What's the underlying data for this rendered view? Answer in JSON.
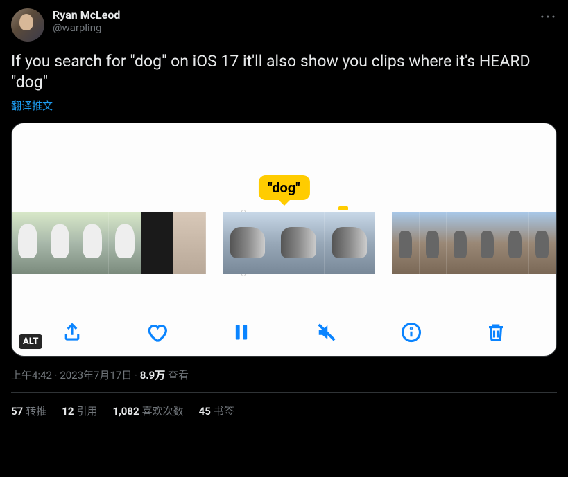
{
  "author": {
    "display_name": "Ryan McLeod",
    "handle": "@warpling"
  },
  "body": "If you search for \"dog\" on iOS 17 it'll also show you clips where it's HEARD \"dog\"",
  "translate_label": "翻译推文",
  "media": {
    "tooltip": "\"dog\"",
    "alt_badge": "ALT"
  },
  "meta": {
    "time": "上午4:42",
    "sep1": " · ",
    "date": "2023年7月17日",
    "sep2": " · ",
    "views_num": "8.9万",
    "views_label": " 查看"
  },
  "stats": {
    "retweets_num": "57",
    "retweets_label": "转推",
    "quotes_num": "12",
    "quotes_label": "引用",
    "likes_num": "1,082",
    "likes_label": "喜欢次数",
    "bookmarks_num": "45",
    "bookmarks_label": "书签"
  }
}
